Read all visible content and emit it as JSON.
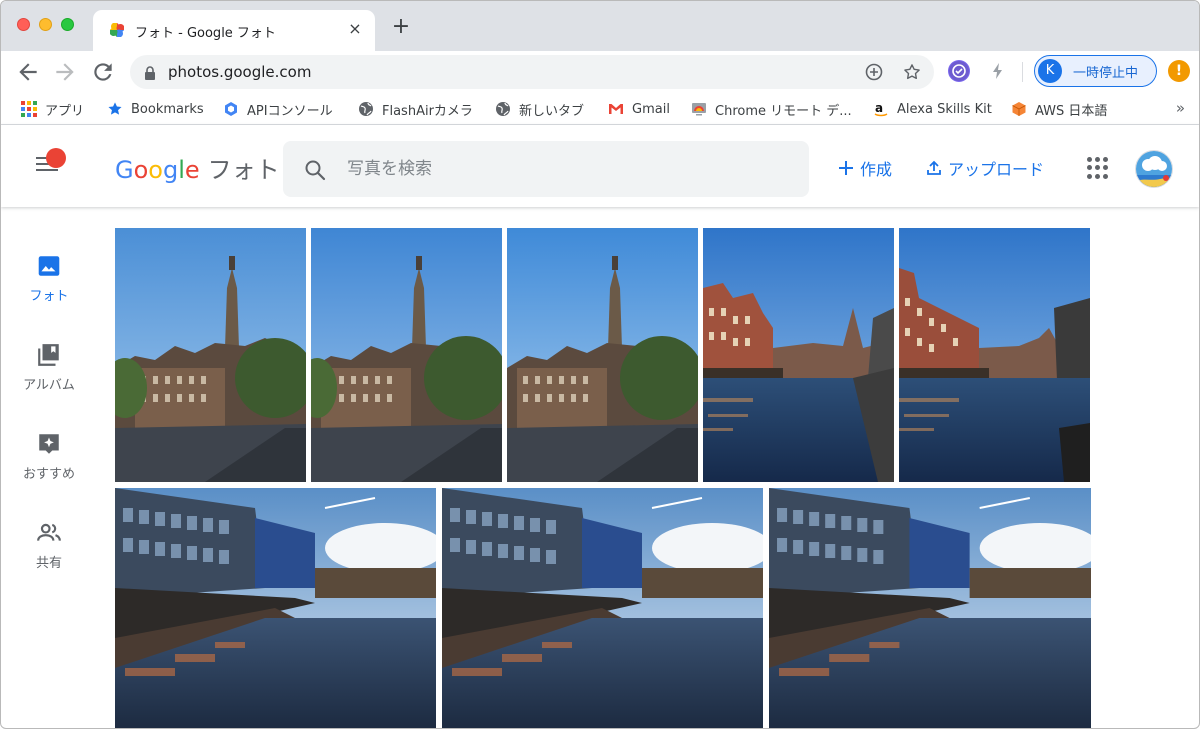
{
  "browser": {
    "tab_title": "フォト - Google フォト",
    "tab_close": "×",
    "new_tab": "+",
    "url": "photos.google.com",
    "profile_initial": "K",
    "profile_status": "一時停止中",
    "update_badge": "!"
  },
  "bookmarks": [
    {
      "label": "アプリ",
      "icon": "apps-grid-icon"
    },
    {
      "label": "Bookmarks",
      "icon": "star-icon"
    },
    {
      "label": "APIコンソール",
      "icon": "hexagon-icon"
    },
    {
      "label": "FlashAirカメラ",
      "icon": "globe-icon"
    },
    {
      "label": "新しいタブ",
      "icon": "globe-icon"
    },
    {
      "label": "Gmail",
      "icon": "gmail-icon"
    },
    {
      "label": "Chrome リモート デ...",
      "icon": "remote-desktop-icon"
    },
    {
      "label": "Alexa Skills Kit",
      "icon": "amazon-icon"
    },
    {
      "label": "AWS 日本語",
      "icon": "aws-cube-icon"
    }
  ],
  "bookmarks_overflow": "»",
  "app": {
    "logo_letters": [
      "G",
      "o",
      "o",
      "g",
      "l",
      "e"
    ],
    "logo_product": "フォト",
    "search_placeholder": "写真を検索",
    "create_label": "作成",
    "upload_label": "アップロード"
  },
  "nav": [
    {
      "label": "フォト",
      "icon": "photo-icon",
      "active": true
    },
    {
      "label": "アルバム",
      "icon": "album-icon",
      "active": false
    },
    {
      "label": "おすすめ",
      "icon": "assistant-icon",
      "active": false
    },
    {
      "label": "共有",
      "icon": "sharing-icon",
      "active": false
    }
  ],
  "colors": {
    "accent": "#1a73e8",
    "toolbar_bg": "#dee1e6",
    "search_bg": "#f1f3f4"
  }
}
